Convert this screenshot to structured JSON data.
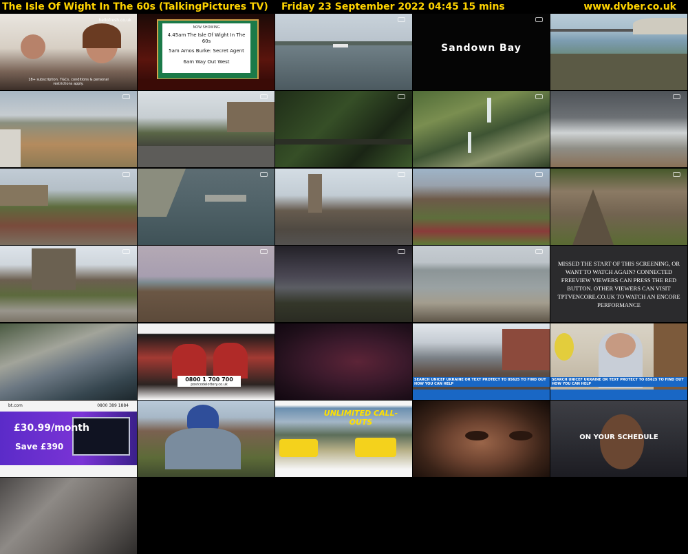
{
  "header": {
    "title": "The Isle Of Wight In The 60s (TalkingPictures TV)",
    "datetime": "Friday 23 September 2022  04:45  15 mins",
    "site": "www.dvber.co.uk"
  },
  "thumbnails": [
    {
      "caption": "hellofresh.co.uk",
      "subcaption": "18+ subscription. T&Cs, conditions & personal restrictions apply."
    },
    {
      "line1": "NOW SHOWING",
      "line2": "4.45am The Isle Of Wight In The 60s",
      "line3": "5am Amos Burke: Secret Agent",
      "line4": "6am Way Out West"
    },
    {},
    {
      "caption": "Sandown Bay"
    },
    {},
    {},
    {},
    {},
    {},
    {},
    {},
    {},
    {},
    {},
    {},
    {},
    {},
    {},
    {},
    {
      "caption": "MISSED THE START OF THIS SCREENING, OR WANT TO WATCH AGAIN? CONNECTED FREEVIEW VIEWERS CAN PRESS THE RED BUTTON. OTHER VIEWERS CAN VISIT TPTVENCORE.CO.UK TO WATCH AN ENCORE PERFORMANCE"
    },
    {},
    {
      "caption": "0800 1 700 700",
      "subcaption": "postcodelottery.co.uk"
    },
    {},
    {
      "caption": "SEARCH UNICEF UKRAINE OR TEXT PROTECT TO 85625 TO FIND OUT HOW YOU CAN HELP"
    },
    {
      "caption": "SEARCH UNICEF UKRAINE OR TEXT PROTECT TO 85625 TO FIND OUT HOW YOU CAN HELP"
    },
    {
      "caption": "bt.com",
      "phone": "0800 389 1884",
      "price": "£30.99/month",
      "save": "Save £390"
    },
    {},
    {
      "caption": "UNLIMITED CALL-OUTS"
    },
    {},
    {
      "caption": "ON YOUR SCHEDULE"
    },
    {}
  ]
}
